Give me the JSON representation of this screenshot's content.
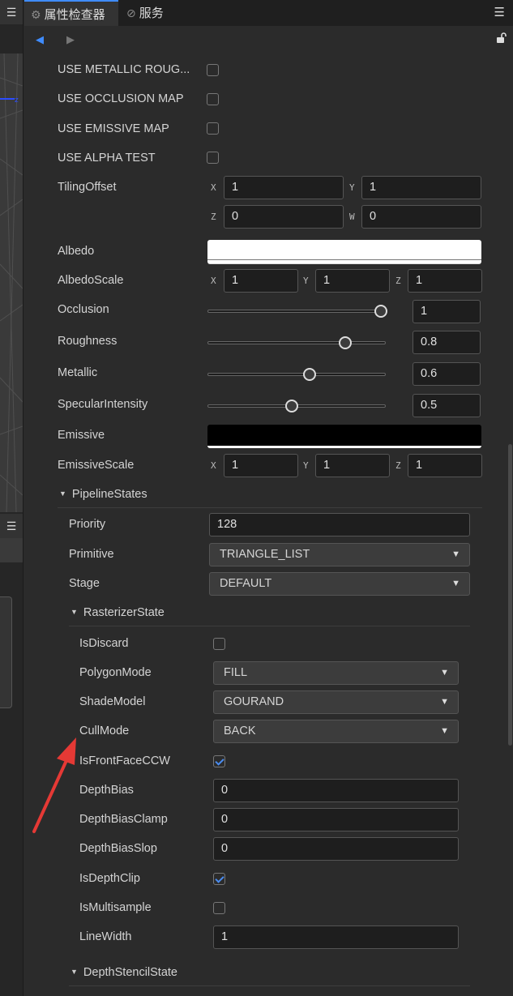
{
  "tabs": {
    "inspector": "属性检查器",
    "services": "服务"
  },
  "material": {
    "use_metallic": "USE METALLIC ROUG...",
    "use_occlusion": "USE OCCLUSION MAP",
    "use_emissive": "USE EMISSIVE MAP",
    "use_alpha": "USE ALPHA TEST",
    "tiling_label": "TilingOffset",
    "tiling_x": "1",
    "tiling_y": "1",
    "tiling_z": "0",
    "tiling_w": "0",
    "albedo_label": "Albedo",
    "albedo_color": "#ffffff",
    "albedo_scale_label": "AlbedoScale",
    "albedo_scale_x": "1",
    "albedo_scale_y": "1",
    "albedo_scale_z": "1",
    "occlusion_label": "Occlusion",
    "occlusion_value": "1",
    "roughness_label": "Roughness",
    "roughness_value": "0.8",
    "metallic_label": "Metallic",
    "metallic_value": "0.6",
    "specular_label": "SpecularIntensity",
    "specular_value": "0.5",
    "emissive_label": "Emissive",
    "emissive_color": "#000000",
    "emissive_scale_label": "EmissiveScale",
    "emissive_scale_x": "1",
    "emissive_scale_y": "1",
    "emissive_scale_z": "1"
  },
  "axes": {
    "x": "X",
    "y": "Y",
    "z": "Z",
    "w": "W"
  },
  "pipeline": {
    "section": "PipelineStates",
    "priority_label": "Priority",
    "priority_value": "128",
    "primitive_label": "Primitive",
    "primitive_value": "TRIANGLE_LIST",
    "stage_label": "Stage",
    "stage_value": "DEFAULT"
  },
  "rasterizer": {
    "section": "RasterizerState",
    "is_discard": "IsDiscard",
    "polygon_mode_label": "PolygonMode",
    "polygon_mode_value": "FILL",
    "shade_model_label": "ShadeModel",
    "shade_model_value": "GOURAND",
    "cull_mode_label": "CullMode",
    "cull_mode_value": "BACK",
    "front_face_ccw": "IsFrontFaceCCW",
    "depth_bias_label": "DepthBias",
    "depth_bias_value": "0",
    "depth_bias_clamp_label": "DepthBiasClamp",
    "depth_bias_clamp_value": "0",
    "depth_bias_slop_label": "DepthBiasSlop",
    "depth_bias_slop_value": "0",
    "depth_clip": "IsDepthClip",
    "multisample": "IsMultisample",
    "line_width_label": "LineWidth",
    "line_width_value": "1"
  },
  "depth_stencil": {
    "section": "DepthStencilState"
  },
  "states": {
    "use_metallic_checked": false,
    "use_occlusion_checked": false,
    "use_emissive_checked": false,
    "use_alpha_checked": false,
    "is_discard_checked": false,
    "front_face_ccw_checked": true,
    "depth_clip_checked": true,
    "multisample_checked": false,
    "occlusion_slider": 1.0,
    "roughness_slider": 0.8,
    "metallic_slider": 0.6,
    "specular_slider": 0.5
  },
  "icons": [
    "gear-icon",
    "link-icon",
    "menu-icon",
    "back-arrow-icon",
    "forward-arrow-icon",
    "unlock-icon",
    "triangle-down-icon",
    "annotation-arrow"
  ],
  "colors": {
    "accent": "#3f8cff",
    "annotation": "#e53935"
  }
}
